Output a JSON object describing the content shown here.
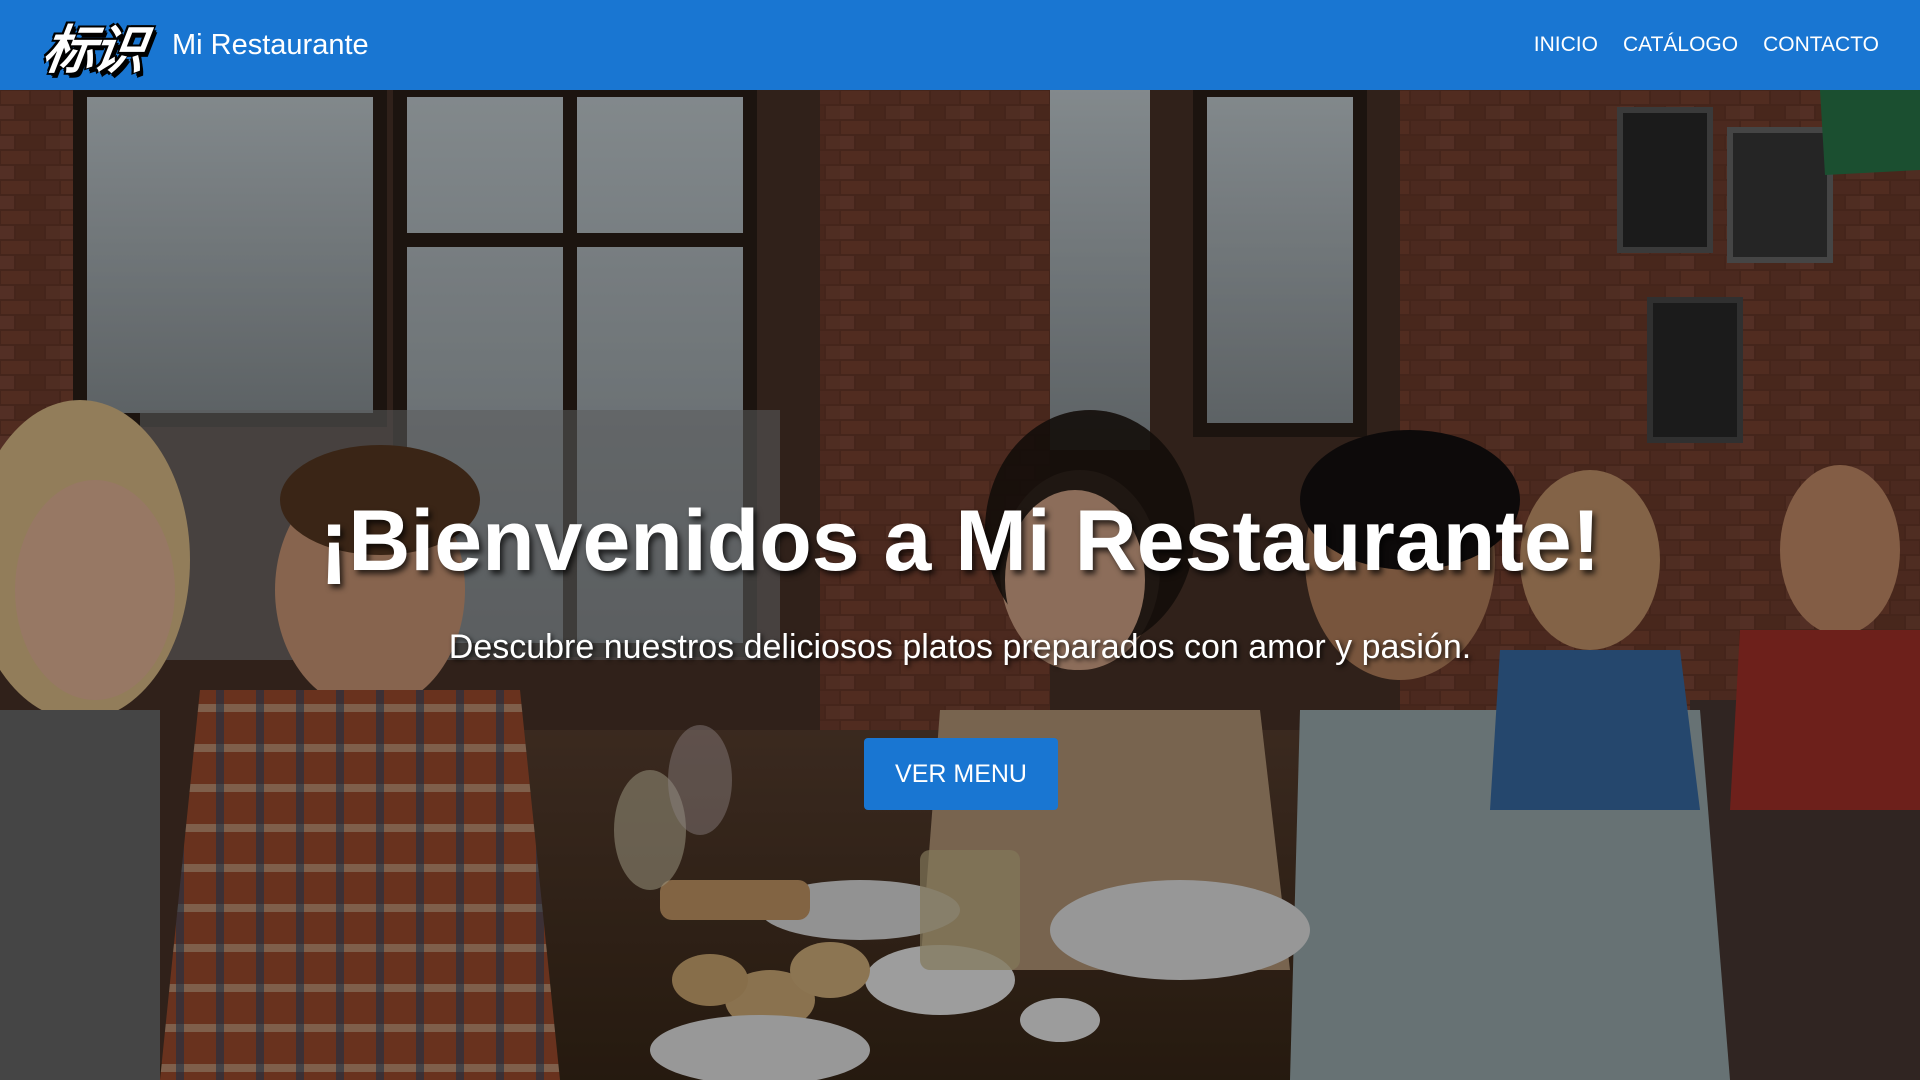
{
  "brand": {
    "logo_text": "标识",
    "name": "Mi Restaurante"
  },
  "nav": {
    "items": [
      {
        "label": "INICIO"
      },
      {
        "label": "CATÁLOGO"
      },
      {
        "label": "CONTACTO"
      }
    ]
  },
  "hero": {
    "title": "¡Bienvenidos a Mi Restaurante!",
    "subtitle": "Descubre nuestros deliciosos platos preparados con amor y pasión.",
    "cta_label": "VER MENU",
    "background_icon": "restaurant-diners-photo"
  },
  "colors": {
    "primary": "#1976d2",
    "text_on_primary": "#ffffff"
  }
}
